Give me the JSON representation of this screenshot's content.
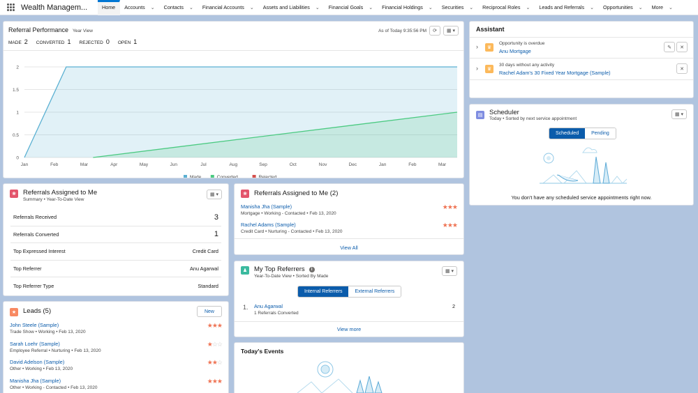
{
  "nav": {
    "app_name": "Wealth Managem...",
    "tabs": [
      {
        "label": "Home",
        "active": true,
        "dropdown": false
      },
      {
        "label": "Accounts",
        "dropdown": true
      },
      {
        "label": "Contacts",
        "dropdown": true
      },
      {
        "label": "Financial Accounts",
        "dropdown": true
      },
      {
        "label": "Assets and Liabilities",
        "dropdown": true
      },
      {
        "label": "Financial Goals",
        "dropdown": true
      },
      {
        "label": "Financial Holdings",
        "dropdown": true
      },
      {
        "label": "Securities",
        "dropdown": true
      },
      {
        "label": "Reciprocal Roles",
        "dropdown": true
      },
      {
        "label": "Leads and Referrals",
        "dropdown": true
      },
      {
        "label": "Opportunities",
        "dropdown": true
      },
      {
        "label": "More",
        "dropdown": true
      }
    ]
  },
  "referral_performance": {
    "title": "Referral Performance",
    "view": "Year View",
    "as_of": "As of Today 9:35:56 PM",
    "stats": [
      {
        "label": "MADE",
        "value": "2"
      },
      {
        "label": "CONVERTED",
        "value": "1"
      },
      {
        "label": "REJECTED",
        "value": "0"
      },
      {
        "label": "OPEN",
        "value": "1"
      }
    ]
  },
  "chart_data": {
    "type": "area",
    "x": [
      "Jan",
      "Feb",
      "Mar",
      "Apr",
      "May",
      "Jun",
      "Jul",
      "Aug",
      "Sep",
      "Oct",
      "Nov",
      "Dec",
      "Jan",
      "Feb",
      "Mar"
    ],
    "ylim": [
      0,
      2
    ],
    "yticks": [
      "0",
      "0.5",
      "1",
      "1.5",
      "2"
    ],
    "series": [
      {
        "name": "Made",
        "color": "#5ab0d2",
        "points": [
          [
            0,
            0
          ],
          [
            1.4,
            2
          ],
          [
            14.5,
            2
          ]
        ]
      },
      {
        "name": "Converted",
        "color": "#4bca81",
        "points": [
          [
            2.3,
            0
          ],
          [
            14.5,
            1
          ]
        ]
      },
      {
        "name": "Rejected",
        "color": "#d4504c",
        "points": []
      }
    ],
    "legend_position": "bottom"
  },
  "assistant": {
    "title": "Assistant",
    "items": [
      {
        "caption": "Opportunity is overdue",
        "link": "Anu Mortgage"
      },
      {
        "caption": "30 days without any activity",
        "link": "Rachel Adam's 30 Fixed Year Mortgage (Sample)"
      }
    ]
  },
  "scheduler": {
    "title": "Scheduler",
    "subtitle": "Today  •  Sorted by next service appointment",
    "tab_scheduled": "Scheduled",
    "tab_pending": "Pending",
    "empty": "You don't have any scheduled service appointments right now."
  },
  "ref_summary": {
    "title": "Referrals Assigned to Me",
    "subtitle": "Summary  •  Year-To-Date View",
    "rows": [
      {
        "label": "Referrals Received",
        "value": "3",
        "big": true
      },
      {
        "label": "Referrals Converted",
        "value": "1",
        "big": true
      },
      {
        "label": "Top Expressed Interest",
        "value": "Credit Card"
      },
      {
        "label": "Top Referrer",
        "value": "Anu Agarwal"
      },
      {
        "label": "Top Referrer Type",
        "value": "Standard"
      }
    ]
  },
  "ref_list": {
    "title": "Referrals Assigned to Me (2)",
    "items": [
      {
        "name": "Manisha Jha (Sample)",
        "meta": "Mortgage  •  Working - Contacted  •  Feb 13, 2020",
        "stars": 3
      },
      {
        "name": "Rachel Adams (Sample)",
        "meta": "Credit Card  •  Nurturing - Contacted  •  Feb 13, 2020",
        "stars": 3
      }
    ],
    "view_all": "View All"
  },
  "top_referrers": {
    "title": "My Top Referrers",
    "subtitle": "Year-To-Date View  •  Sorted By Made",
    "tab_internal": "Internal Referrers",
    "tab_external": "External Referrers",
    "items": [
      {
        "rank": "1.",
        "name": "Anu Agarwal",
        "meta": "1 Referrals Converted",
        "count": "2"
      }
    ],
    "view_more": "View more"
  },
  "leads": {
    "title": "Leads (5)",
    "new_label": "New",
    "items": [
      {
        "name": "John Steele (Sample)",
        "meta": "Trade Show  •  Working  •  Feb 13, 2020",
        "stars": 3
      },
      {
        "name": "Sarah Loehr (Sample)",
        "meta": "Employee Referral  •  Nurturing  •  Feb 13, 2020",
        "stars": 1
      },
      {
        "name": "David Adelson (Sample)",
        "meta": "Other  •  Working  •  Feb 13, 2020",
        "stars": 2
      },
      {
        "name": "Manisha Jha (Sample)",
        "meta": "Other  •  Working - Contacted  •  Feb 13, 2020",
        "stars": 3
      }
    ]
  },
  "events": {
    "title": "Today's Events"
  }
}
